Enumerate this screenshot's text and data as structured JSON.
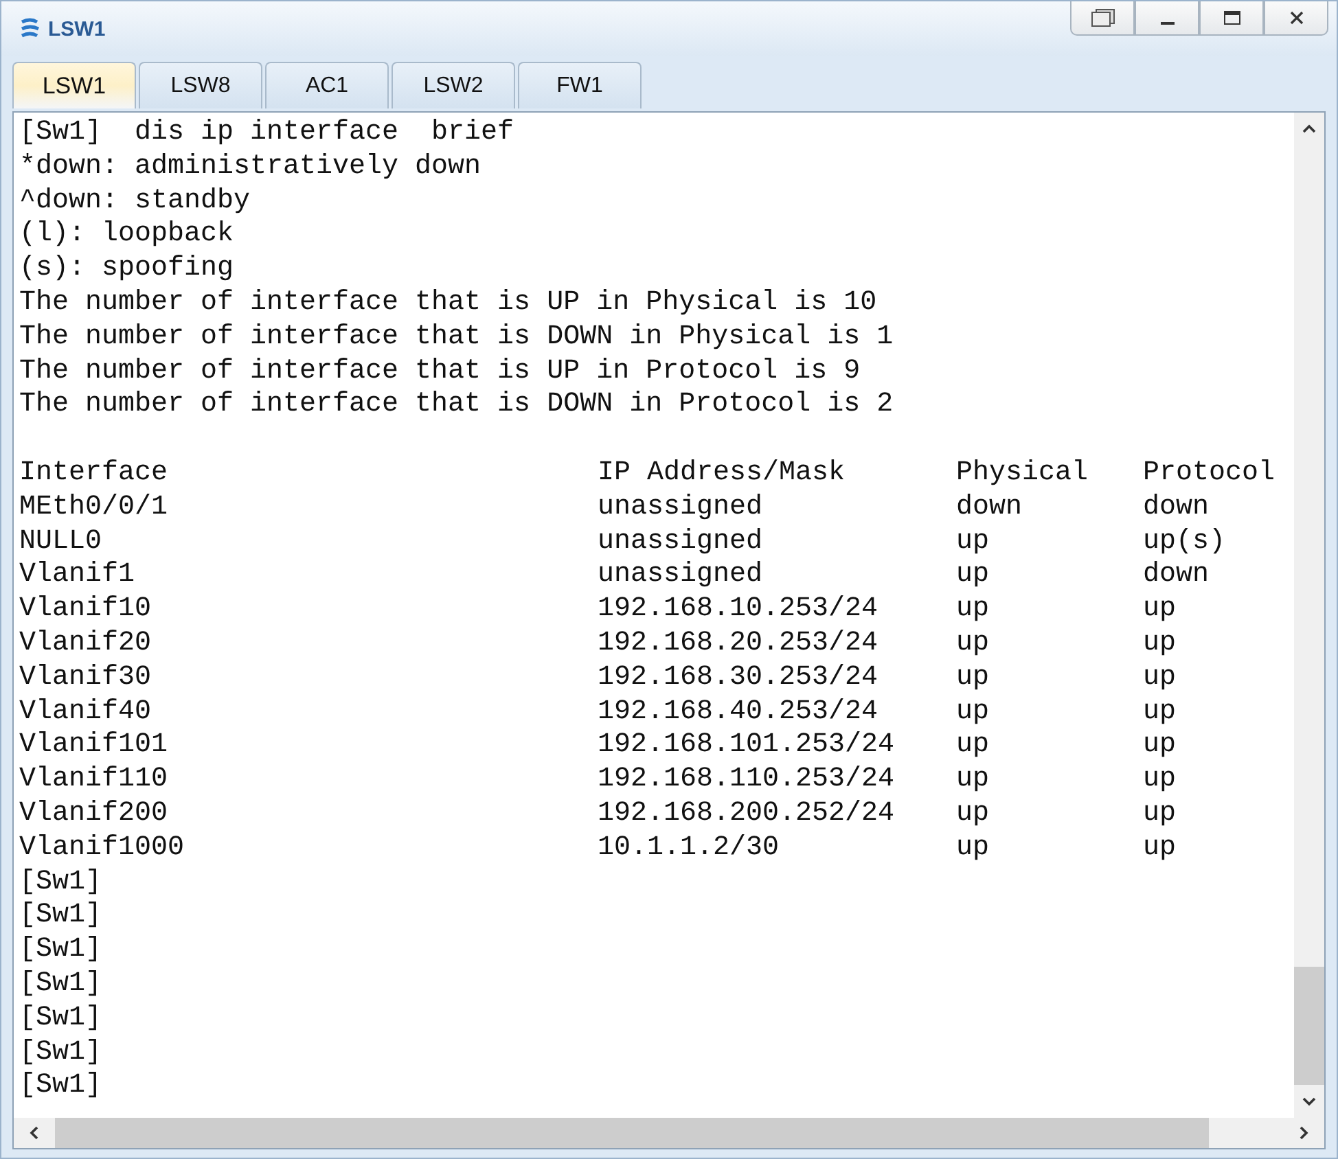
{
  "window": {
    "title": "LSW1"
  },
  "tabs": [
    {
      "label": "LSW1",
      "selected": true
    },
    {
      "label": "LSW8",
      "selected": false
    },
    {
      "label": "AC1",
      "selected": false
    },
    {
      "label": "LSW2",
      "selected": false
    },
    {
      "label": "FW1",
      "selected": false
    }
  ],
  "terminal": {
    "lines": [
      "[Sw1]  dis ip interface  brief",
      "*down: administratively down",
      "^down: standby",
      "(l): loopback",
      "(s): spoofing",
      "The number of interface that is UP in Physical is 10",
      "The number of interface that is DOWN in Physical is 1",
      "The number of interface that is UP in Protocol is 9",
      "The number of interface that is DOWN in Protocol is 2"
    ],
    "table": {
      "columns": [
        "Interface",
        "IP Address/Mask",
        "Physical",
        "Protocol"
      ],
      "rows": [
        [
          "MEth0/0/1",
          "unassigned",
          "down",
          "down"
        ],
        [
          "NULL0",
          "unassigned",
          "up",
          "up(s)"
        ],
        [
          "Vlanif1",
          "unassigned",
          "up",
          "down"
        ],
        [
          "Vlanif10",
          "192.168.10.253/24",
          "up",
          "up"
        ],
        [
          "Vlanif20",
          "192.168.20.253/24",
          "up",
          "up"
        ],
        [
          "Vlanif30",
          "192.168.30.253/24",
          "up",
          "up"
        ],
        [
          "Vlanif40",
          "192.168.40.253/24",
          "up",
          "up"
        ],
        [
          "Vlanif101",
          "192.168.101.253/24",
          "up",
          "up"
        ],
        [
          "Vlanif110",
          "192.168.110.253/24",
          "up",
          "up"
        ],
        [
          "Vlanif200",
          "192.168.200.252/24",
          "up",
          "up"
        ],
        [
          "Vlanif1000",
          "10.1.1.2/30",
          "up",
          "up"
        ]
      ]
    },
    "prompts": [
      "[Sw1]",
      "[Sw1]",
      "[Sw1]",
      "[Sw1]",
      "[Sw1]",
      "[Sw1]",
      "[Sw1]"
    ]
  }
}
